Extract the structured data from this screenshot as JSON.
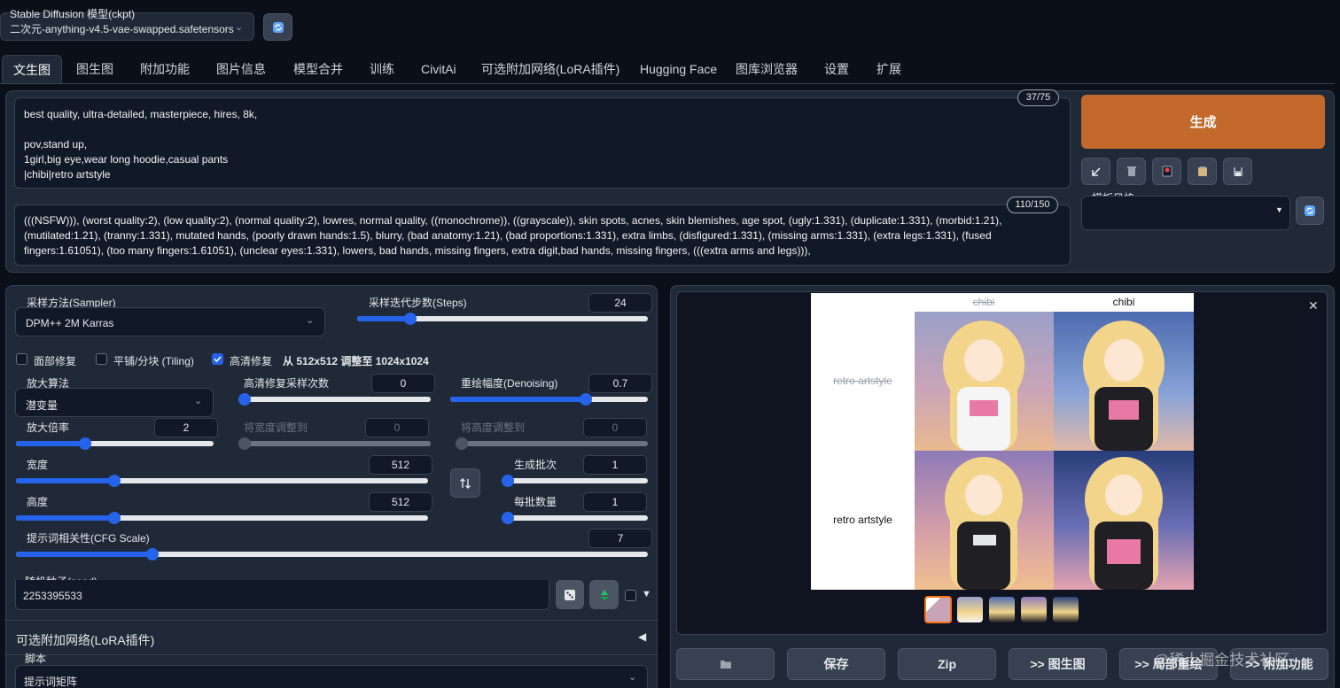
{
  "model": {
    "label": "Stable Diffusion 模型(ckpt)",
    "value": "二次元-anything-v4.5-vae-swapped.safetensors"
  },
  "tabs": [
    "文生图",
    "图生图",
    "附加功能",
    "图片信息",
    "模型合并",
    "训练",
    "CivitAi",
    "可选附加网络(LoRA插件)",
    "Hugging Face",
    "图库浏览器",
    "设置",
    "扩展"
  ],
  "prompt": {
    "counter": "37/75",
    "text": "best quality, ultra-detailed, masterpiece, hires, 8k,\n\npov,stand up,\n1girl,big eye,wear long hoodie,casual pants\n|chibi|retro artstyle"
  },
  "negative": {
    "counter": "110/150",
    "text": "(((NSFW))), (worst quality:2), (low quality:2), (normal quality:2), lowres, normal quality, ((monochrome)), ((grayscale)), skin spots, acnes, skin blemishes, age spot, (ugly:1.331), (duplicate:1.331), (morbid:1.21), (mutilated:1.21), (tranny:1.331), mutated hands, (poorly drawn hands:1.5), blurry, (bad anatomy:1.21), (bad proportions:1.331), extra limbs, (disfigured:1.331), (missing arms:1.331), (extra legs:1.331), (fused fingers:1.61051), (too many fingers:1.61051), (unclear eyes:1.331), lowers, bad hands, missing fingers, extra digit,bad hands, missing fingers, (((extra arms and legs))),"
  },
  "generate": {
    "label": "生成"
  },
  "style": {
    "label": "模板风格"
  },
  "sampler": {
    "label": "采样方法(Sampler)",
    "value": "DPM++ 2M Karras"
  },
  "steps": {
    "label": "采样迭代步数(Steps)",
    "value": "24",
    "fraction": 0.17
  },
  "checkboxes": {
    "face": "面部修复",
    "tiling": "平铺/分块 (Tiling)",
    "hires": "高清修复",
    "hires_info": "从 512x512 调整至 1024x1024"
  },
  "upscaler": {
    "label": "放大算法",
    "value": "潜变量"
  },
  "hires_steps": {
    "label": "高清修复采样次数",
    "value": "0",
    "fraction": 0.0
  },
  "denoising": {
    "label": "重绘幅度(Denoising)",
    "value": "0.7",
    "fraction": 0.7
  },
  "upscale_by": {
    "label": "放大倍率",
    "value": "2",
    "fraction": 0.34
  },
  "resize_w": {
    "label": "将宽度调整到",
    "value": "0",
    "fraction": 0.0
  },
  "resize_h": {
    "label": "将高度调整到",
    "value": "0",
    "fraction": 0.0
  },
  "width": {
    "label": "宽度",
    "value": "512",
    "fraction": 0.23
  },
  "height": {
    "label": "高度",
    "value": "512",
    "fraction": 0.23
  },
  "batch_count": {
    "label": "生成批次",
    "value": "1",
    "fraction": 0.0
  },
  "batch_size": {
    "label": "每批数量",
    "value": "1",
    "fraction": 0.0
  },
  "cfg": {
    "label": "提示词相关性(CFG Scale)",
    "value": "7",
    "fraction": 0.21
  },
  "seed": {
    "label": "随机种子(seed)",
    "value": "2253395533"
  },
  "lora": {
    "label": "可选附加网络(LoRA插件)"
  },
  "script": {
    "label": "脚本",
    "value": "提示词矩阵"
  },
  "grid": {
    "col_a": "chibi",
    "col_b": "chibi",
    "row_a": "retro artstyle",
    "row_b": "retro artstyle"
  },
  "actions": [
    "保存",
    "Zip",
    ">> 图生图",
    ">> 局部重绘",
    ">> 附加功能"
  ],
  "watermark": "@稀土掘金技术社区",
  "colors": {
    "background": "#0b0f19",
    "panel": "#1f2937",
    "accent": "#c2692b",
    "slider": "#2563eb"
  },
  "icons": [
    "refresh-icon",
    "arrow-down-left-icon",
    "trash-icon",
    "red-card-icon",
    "clipboard-icon",
    "save-icon",
    "dice-icon",
    "recycle-icon",
    "swap-icon",
    "folder-icon",
    "close-icon"
  ]
}
